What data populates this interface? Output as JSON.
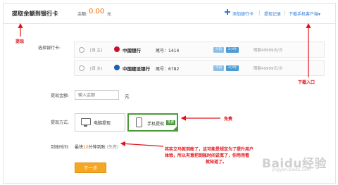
{
  "header": {
    "title": "提取余额到银行卡",
    "balance_label": "余额:",
    "balance_amount": "0.00",
    "balance_unit": "元",
    "links": {
      "add_card": "添加银行卡",
      "records": "提现记录",
      "download": "下载手机客户端▾"
    }
  },
  "form": {
    "select_card_label": "选择银行卡:",
    "cards": [
      {
        "default_tag": "[设 主]",
        "bank_name": "中国银行",
        "card_tail": "尾号：1414",
        "tag1": "今日",
        "tag2": "2小时",
        "limit": "限额49999元/次",
        "logo_color": "#c8102e"
      },
      {
        "default_tag": "[设 主]",
        "bank_name": "中国建设银行",
        "card_tail": "尾号：6782",
        "tag1": "今日",
        "tag2": "2小时",
        "limit": "限额49999元/次",
        "logo_color": "#1a5fb4"
      }
    ],
    "amount_label": "提现金额:",
    "amount_placeholder": "输入金额",
    "amount_unit": "元",
    "method_label": "提现方式:",
    "method_pc": "电脑提现",
    "method_mobile": "手机提现",
    "free_badge": "免费",
    "arrival_label": "到账时间:",
    "arrival_prefix": "最快",
    "arrival_minutes": "10",
    "arrival_suffix": "分钟到账",
    "arrival_note": "(免费)",
    "next_button": "下一步"
  },
  "annotations": {
    "withdraw": "提现",
    "download_entry": "下载入口",
    "free": "免费",
    "note_line1": "其实立马就到账了，这可能是规定为了提升用户",
    "note_line2": "体验，所以有意把到账时间说宽了，你用用看",
    "note_line3": "就知道了。"
  },
  "watermark": {
    "brand": "Baidu经验",
    "url": "jingyan.baidu.com"
  }
}
